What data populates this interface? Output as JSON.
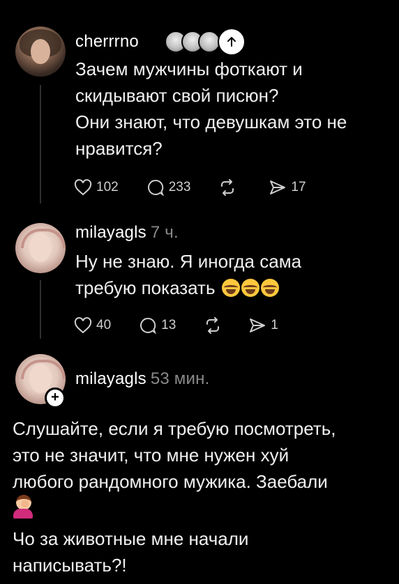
{
  "posts": [
    {
      "username": "cherrrno",
      "text_lines": [
        "Зачем мужчины фоткают и",
        "скидывают свой писюн?",
        "Они знают, что девушкам это не",
        "нравится?"
      ],
      "likes": "102",
      "comments": "233",
      "shares": "17"
    },
    {
      "username": "milayagls",
      "time": "7 ч.",
      "text_lines": [
        "Ну не знаю. Я иногда сама",
        "требую показать"
      ],
      "likes": "40",
      "comments": "13",
      "shares": "1"
    },
    {
      "username": "milayagls",
      "time": "53 мин.",
      "text_lines": [
        "Слушайте, если я требую посмотреть,",
        "это не значит, что мне нужен хуй",
        "любого рандомного мужика. Заебали",
        "Чо за животные мне начали",
        "написывать?!"
      ]
    }
  ],
  "icons": {
    "like": "heart-icon",
    "comment": "comment-icon",
    "repost": "repost-icon",
    "share": "send-icon"
  },
  "colors": {
    "background": "#000000",
    "text": "#f0f0f0",
    "muted": "#8a8a8a"
  }
}
